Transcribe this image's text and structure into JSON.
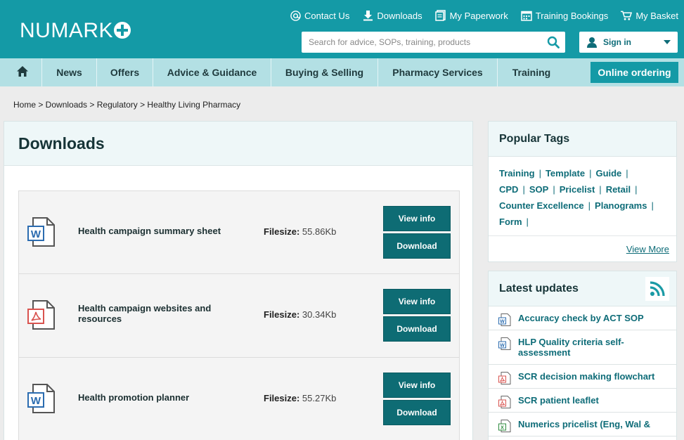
{
  "brand": {
    "name": "NUMARK"
  },
  "toplinks": [
    {
      "label": "Contact Us",
      "icon": "at-icon"
    },
    {
      "label": "Downloads",
      "icon": "download-icon"
    },
    {
      "label": "My Paperwork",
      "icon": "paperwork-icon"
    },
    {
      "label": "Training Bookings",
      "icon": "calendar-icon"
    },
    {
      "label": "My Basket",
      "icon": "basket-icon"
    }
  ],
  "search": {
    "placeholder": "Search for advice, SOPs, training, products"
  },
  "signin": {
    "label": "Sign in"
  },
  "nav": {
    "items": [
      "News",
      "Offers",
      "Advice & Guidance",
      "Buying & Selling",
      "Pharmacy Services",
      "Training"
    ],
    "online": "Online ordering"
  },
  "breadcrumb": "Home > Downloads > Regulatory > Healthy Living Pharmacy",
  "main": {
    "title": "Downloads",
    "filesize_label": "Filesize:",
    "view_label": "View info",
    "download_label": "Download",
    "items": [
      {
        "name": "Health campaign summary sheet",
        "type": "word",
        "size": "55.86Kb"
      },
      {
        "name": "Health campaign websites and resources",
        "type": "pdf",
        "size": "30.34Kb"
      },
      {
        "name": "Health promotion planner",
        "type": "word",
        "size": "55.27Kb"
      }
    ]
  },
  "popular": {
    "title": "Popular Tags",
    "tags": [
      "Training",
      "Template",
      "Guide",
      "CPD",
      "SOP",
      "Pricelist",
      "Retail",
      "Counter Excellence",
      "Planograms",
      "Form"
    ],
    "view_more": "View More"
  },
  "updates": {
    "title": "Latest updates",
    "items": [
      {
        "label": "Accuracy check by ACT SOP",
        "type": "word"
      },
      {
        "label": "HLP Quality criteria self-assessment",
        "type": "word"
      },
      {
        "label": "SCR decision making flowchart",
        "type": "pdf"
      },
      {
        "label": "SCR patient leaflet",
        "type": "pdf"
      },
      {
        "label": "Numerics pricelist (Eng, Wal &",
        "type": "excel"
      }
    ]
  },
  "colors": {
    "teal": "#149aa6",
    "dark_teal": "#0e6c74",
    "nav": "#b3e0e4"
  }
}
